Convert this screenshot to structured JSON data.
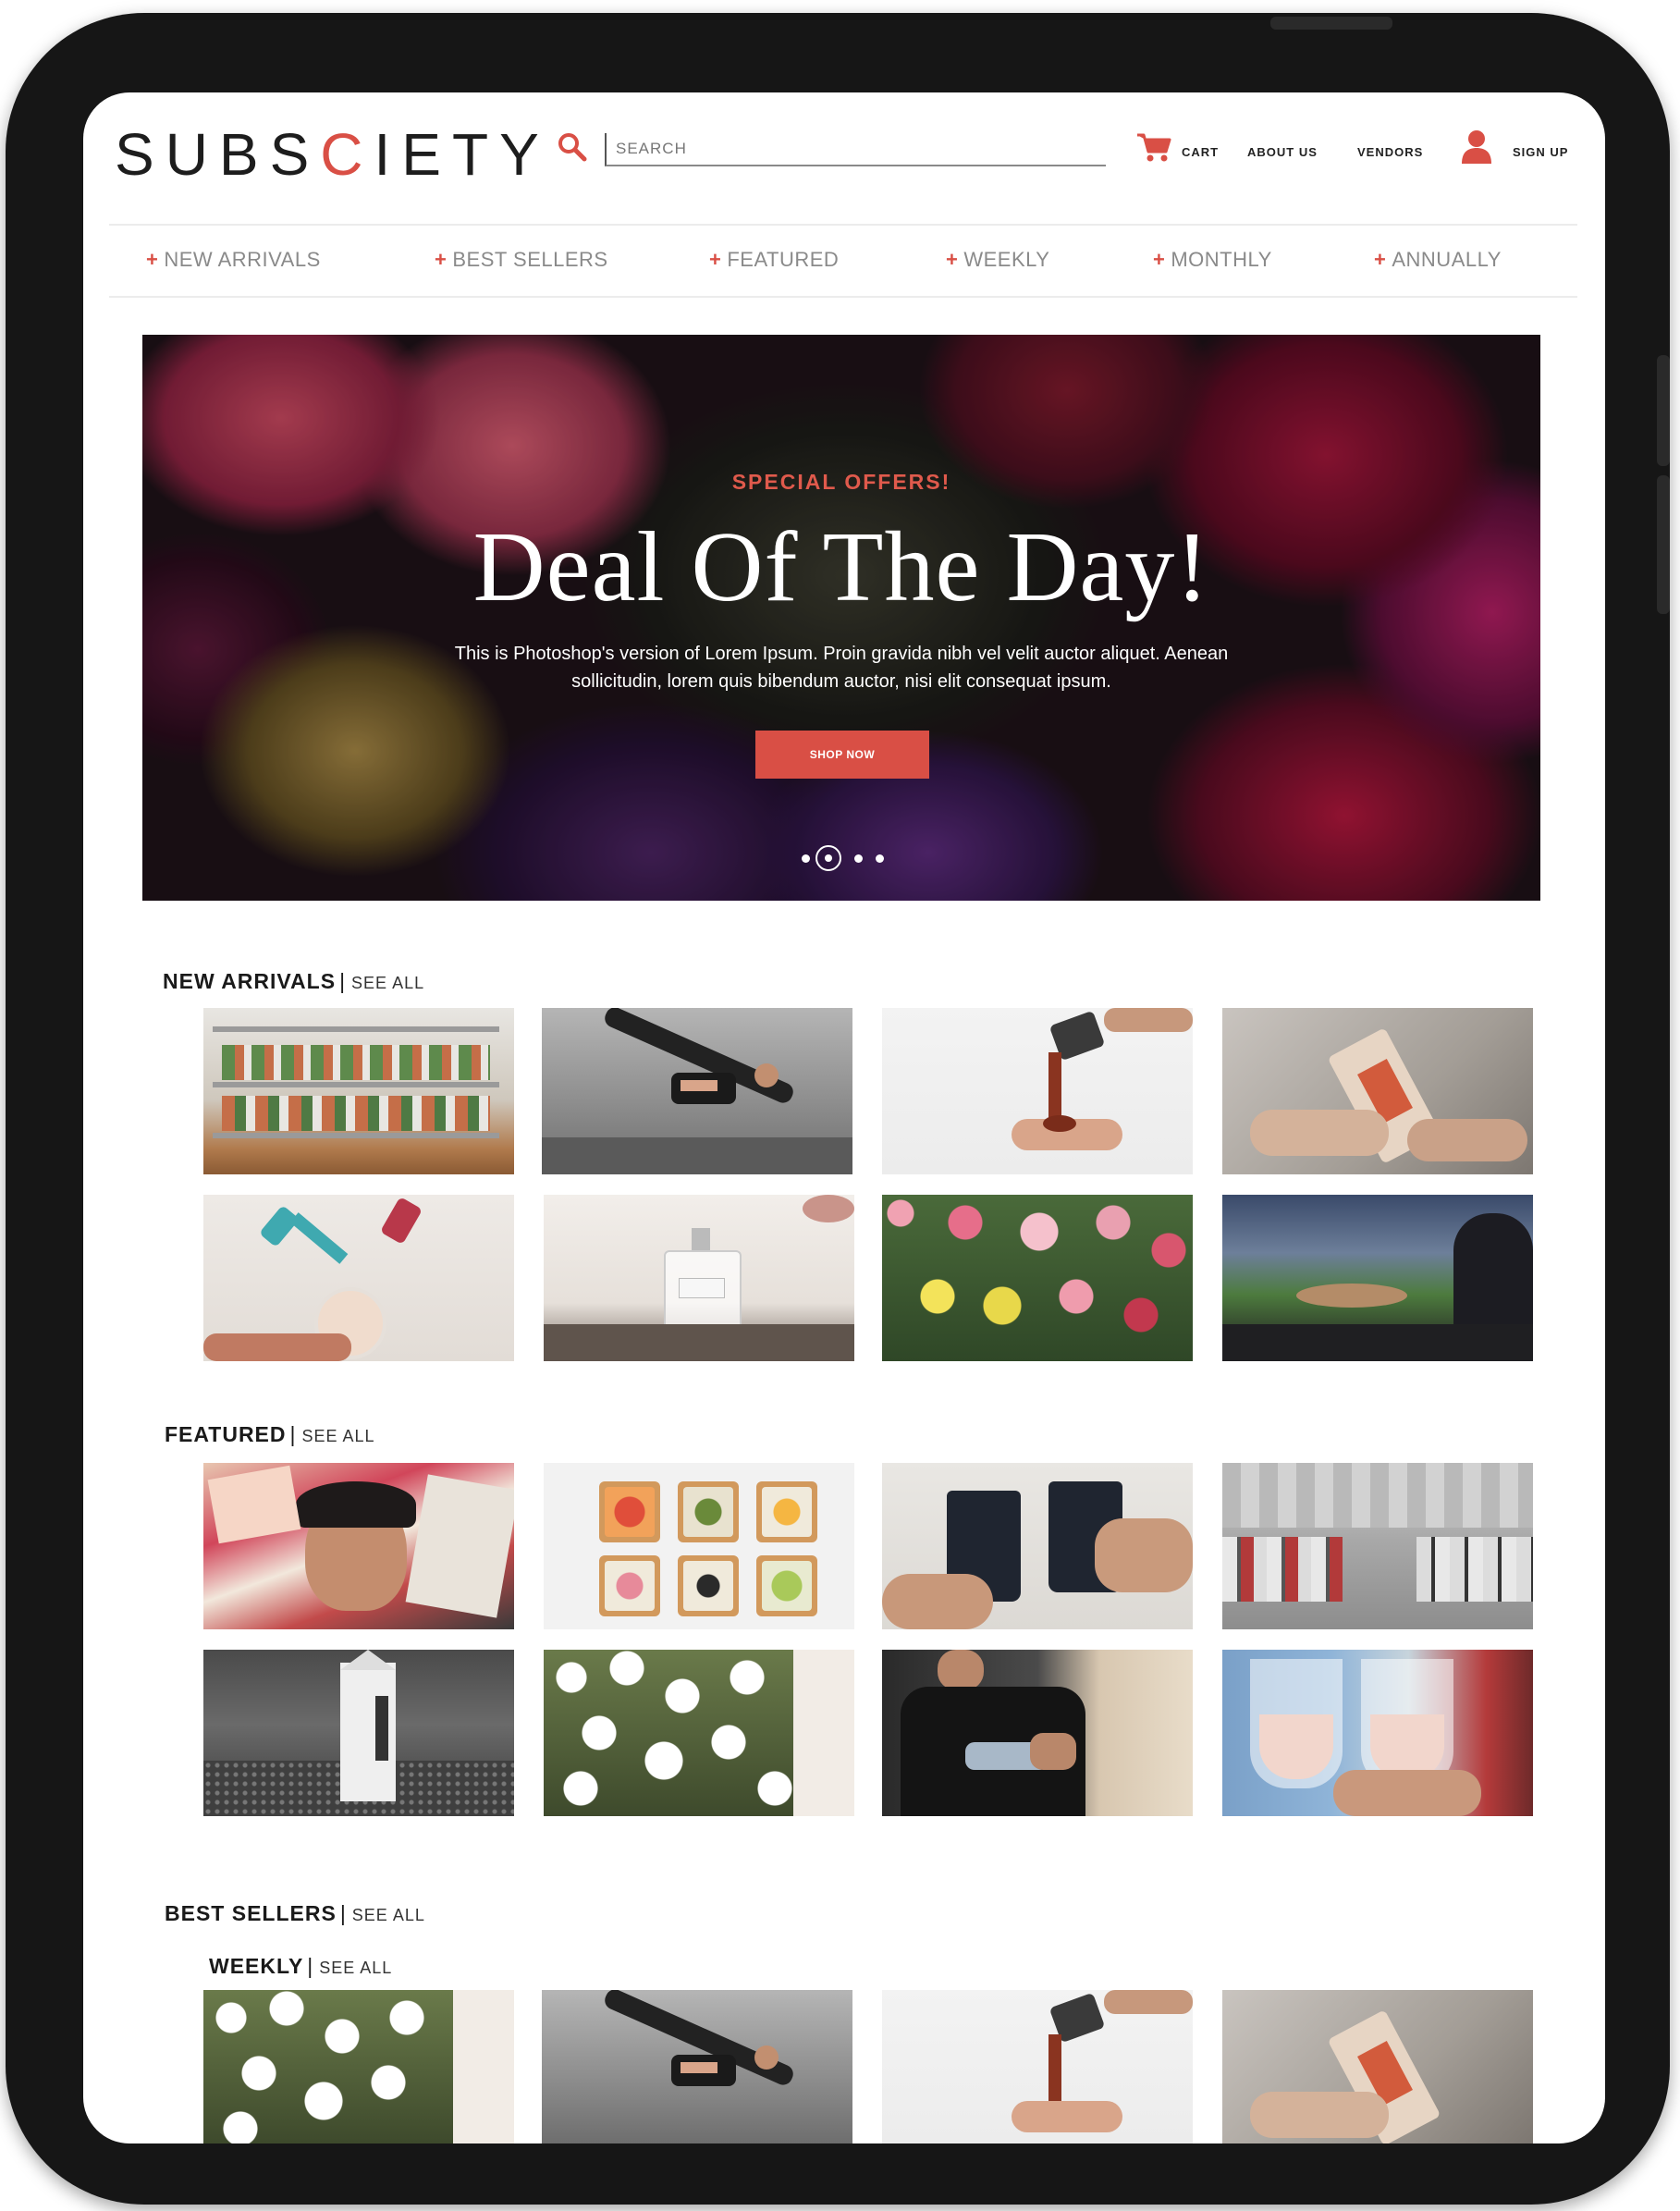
{
  "header": {
    "logo_left": "SUBS",
    "logo_accent": "C",
    "logo_right": "IETY",
    "search_placeholder": "SEARCH",
    "cart": "CART",
    "about": "ABOUT US",
    "vendors": "VENDORS",
    "signup": "SIGN UP"
  },
  "nav": [
    {
      "label": "NEW ARRIVALS"
    },
    {
      "label": "BEST SELLERS"
    },
    {
      "label": "FEATURED"
    },
    {
      "label": "WEEKLY"
    },
    {
      "label": "MONTHLY"
    },
    {
      "label": "ANNUALLY"
    }
  ],
  "hero": {
    "kicker": "SPECIAL OFFERS!",
    "title": "Deal Of The Day!",
    "text": "This is Photoshop's version  of Lorem Ipsum. Proin gravida nibh vel velit auctor aliquet. Aenean sollicitudin, lorem quis bibendum auctor, nisi elit consequat ipsum.",
    "button": "SHOP NOW",
    "slides_total": 4,
    "slide_active": 2
  },
  "sections": {
    "new_arrivals": {
      "title": "NEW ARRIVALS",
      "see_all": "SEE ALL"
    },
    "featured": {
      "title": "FEATURED",
      "see_all": "SEE ALL"
    },
    "best_sellers": {
      "title": "BEST SELLERS",
      "see_all": "SEE ALL"
    },
    "weekly": {
      "title": "WEEKLY",
      "see_all": "SEE ALL"
    }
  },
  "products": {
    "new_arrivals": [
      "succulent plant shelf",
      "yoga side plank",
      "pouring coffee",
      "tea tin in hands",
      "dumbbells and shake",
      "perfume bottle on tray",
      "flower bouquets",
      "baseball stadium"
    ],
    "featured": [
      "vogue magazines",
      "toast platter",
      "madcap coffee cups",
      "parking lot cars",
      "milk carton on rocks",
      "white daisies",
      "boxer wrapping hands",
      "rosé wine glasses"
    ],
    "weekly": [
      "white daisies",
      "yoga side plank",
      "pouring coffee",
      "tea tin in hands"
    ]
  },
  "colors": {
    "accent": "#d94f45",
    "device_frame": "#161616",
    "nav_text": "#8a8a8a"
  }
}
